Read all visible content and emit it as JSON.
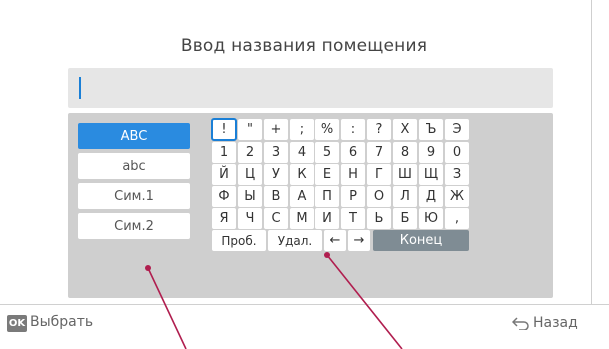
{
  "title": "Ввод названия помещения",
  "input": {
    "value": ""
  },
  "modes": [
    {
      "label": "ABC",
      "active": true
    },
    {
      "label": "abc",
      "active": false
    },
    {
      "label": "Сим.1",
      "active": false
    },
    {
      "label": "Сим.2",
      "active": false
    }
  ],
  "keyboard": {
    "rows": [
      [
        "!",
        "\"",
        "+",
        ";",
        "%",
        ":",
        "?",
        "X",
        "Ъ",
        "Э"
      ],
      [
        "1",
        "2",
        "3",
        "4",
        "5",
        "6",
        "7",
        "8",
        "9",
        "0"
      ],
      [
        "Й",
        "Ц",
        "У",
        "К",
        "Е",
        "Н",
        "Г",
        "Ш",
        "Щ",
        "З"
      ],
      [
        "Ф",
        "Ы",
        "В",
        "А",
        "П",
        "Р",
        "О",
        "Л",
        "Д",
        "Ж"
      ],
      [
        "Я",
        "Ч",
        "С",
        "М",
        "И",
        "Т",
        "Ь",
        "Б",
        "Ю",
        ","
      ]
    ],
    "space_label": "Проб.",
    "delete_label": "Удал.",
    "left_arrow": "←",
    "right_arrow": "→",
    "end_label": "Конец"
  },
  "footer": {
    "ok_badge": "OK",
    "select_label": "Выбрать",
    "back_label": "Назад"
  },
  "colors": {
    "accent": "#2a8be0",
    "focus": "#1a7fd6",
    "panel": "#cfcfcf",
    "end_key": "#7f8c94",
    "callout": "#b01e4f"
  },
  "icons": [
    "back-arrow-icon"
  ]
}
